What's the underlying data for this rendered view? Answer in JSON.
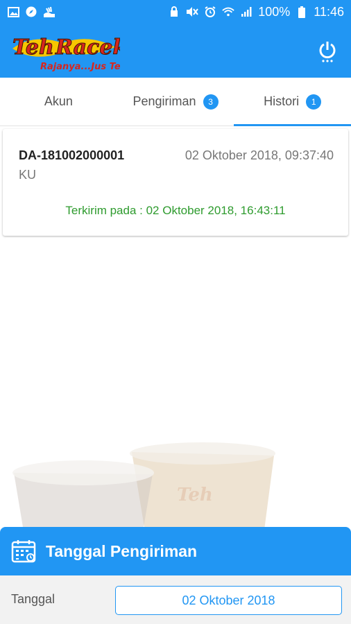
{
  "status_bar": {
    "battery": "100%",
    "time": "11:46",
    "left_icons": [
      "image-icon",
      "compass-icon",
      "hand-icon"
    ],
    "right_icons": [
      "lock-icon",
      "mute-icon",
      "alarm-icon",
      "wifi-icon",
      "signal-icon",
      "battery-icon"
    ]
  },
  "app_bar": {
    "logo_text": "TehRacek",
    "logo_tagline": "Rajanya...Jus Tea",
    "power_icon": "power-icon"
  },
  "tabs": [
    {
      "label": "Akun",
      "badge": ""
    },
    {
      "label": "Pengiriman",
      "badge": "3"
    },
    {
      "label": "Histori",
      "badge": "1"
    }
  ],
  "active_tab": 2,
  "history": [
    {
      "id": "DA-181002000001",
      "datetime": "02 Oktober 2018, 09:37:40",
      "sub": "KU",
      "status": "Terkirim pada : 02 Oktober 2018, 16:43:11"
    }
  ],
  "bottom_panel": {
    "title": "Tanggal Pengiriman",
    "field_label": "Tanggal",
    "field_value": "02 Oktober 2018"
  },
  "colors": {
    "primary": "#2196f3",
    "success": "#2e9b2e",
    "logo_red": "#d7261e",
    "logo_yellow": "#f7c600"
  }
}
